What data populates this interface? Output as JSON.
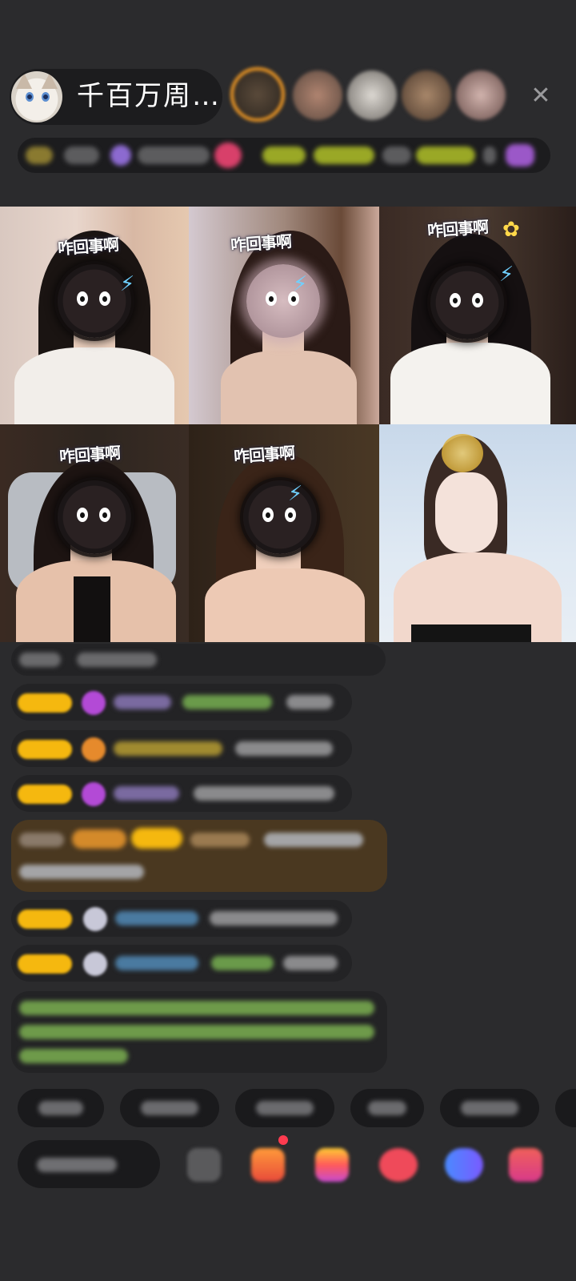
{
  "header": {
    "host_name": "千百万周…",
    "close_glyph": "✕",
    "viewers": [
      {
        "color": "#7a5a3a"
      },
      {
        "color": "#9a7a68"
      },
      {
        "color": "#b7b2ad"
      },
      {
        "color": "#8a6a58"
      },
      {
        "color": "#b89a94"
      }
    ]
  },
  "video_tiles": [
    {
      "sticker": "咋回事啊"
    },
    {
      "sticker": "咋回事啊"
    },
    {
      "sticker": "咋回事啊"
    },
    {
      "sticker": "咋回事啊"
    },
    {
      "sticker": "咋回事啊"
    },
    {
      "sticker": ""
    }
  ],
  "colors": {
    "background": "#2b2b2d",
    "pill": "#1c1c1e",
    "badge_gold": "#f5b80f",
    "gem_purple": "#b34ad6",
    "green_text": "#7bd35a",
    "highlight_brown": "#5a4020"
  }
}
